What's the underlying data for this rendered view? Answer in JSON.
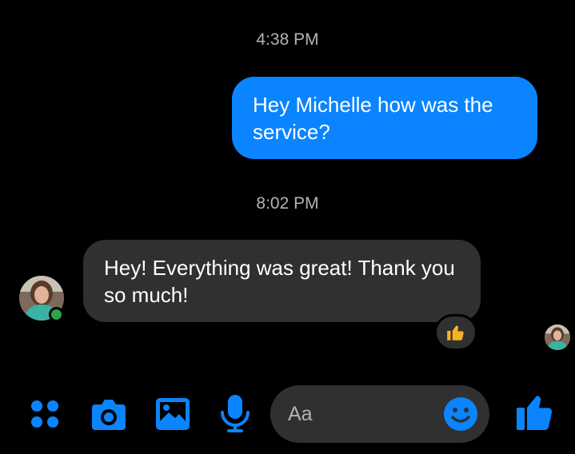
{
  "conversation": {
    "messages": [
      {
        "timestamp": "4:38 PM",
        "direction": "outgoing",
        "text": "Hey Michelle how was the service?"
      },
      {
        "timestamp": "8:02 PM",
        "direction": "incoming",
        "text": "Hey! Everything was great! Thank you so much!",
        "reaction": "thumbs-up"
      }
    ]
  },
  "contact": {
    "online": true,
    "status_color": "#31a24c"
  },
  "composer": {
    "placeholder": "Aa",
    "icons": [
      "apps-icon",
      "camera-icon",
      "gallery-icon",
      "microphone-icon",
      "emoji-icon",
      "like-icon"
    ]
  },
  "theme": {
    "background": "#000000",
    "accent": "#0a84ff",
    "bubble_incoming": "#303030",
    "reaction_color": "#f7b125"
  }
}
